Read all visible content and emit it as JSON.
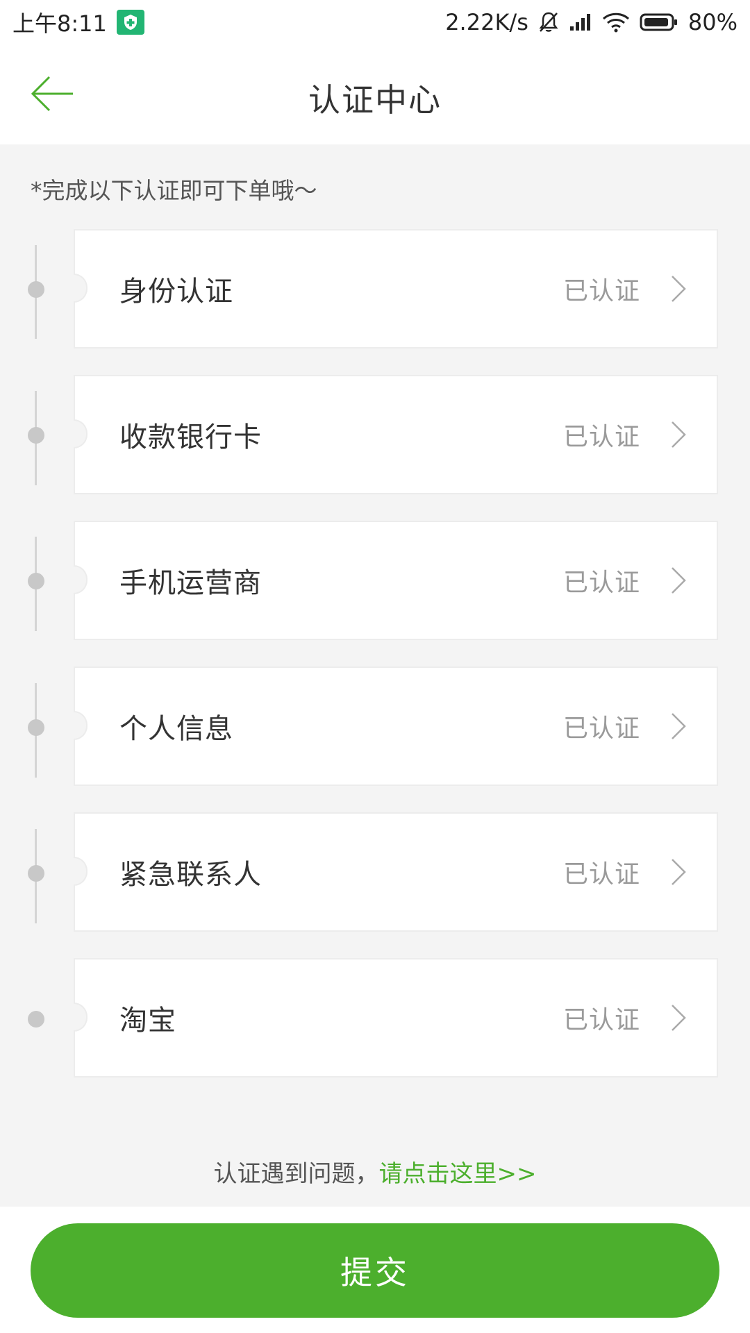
{
  "status_bar": {
    "time": "上午8:11",
    "net_speed": "2.22K/s",
    "battery": "80%",
    "icons": [
      "shield-icon",
      "mute-bell-icon",
      "signal-icon",
      "wifi-icon",
      "battery-icon"
    ]
  },
  "header": {
    "title": "认证中心",
    "back_icon": "arrow-left-icon"
  },
  "hint": "*完成以下认证即可下单哦～",
  "items": [
    {
      "label": "身份认证",
      "status": "已认证"
    },
    {
      "label": "收款银行卡",
      "status": "已认证"
    },
    {
      "label": "手机运营商",
      "status": "已认证"
    },
    {
      "label": "个人信息",
      "status": "已认证"
    },
    {
      "label": "紧急联系人",
      "status": "已认证"
    },
    {
      "label": "淘宝",
      "status": "已认证"
    }
  ],
  "help": {
    "prefix": "认证遇到问题，",
    "link": "请点击这里>>"
  },
  "submit_label": "提交",
  "colors": {
    "accent": "#4caf2d",
    "background": "#f4f4f4",
    "status_text": "#9a9a9a"
  }
}
